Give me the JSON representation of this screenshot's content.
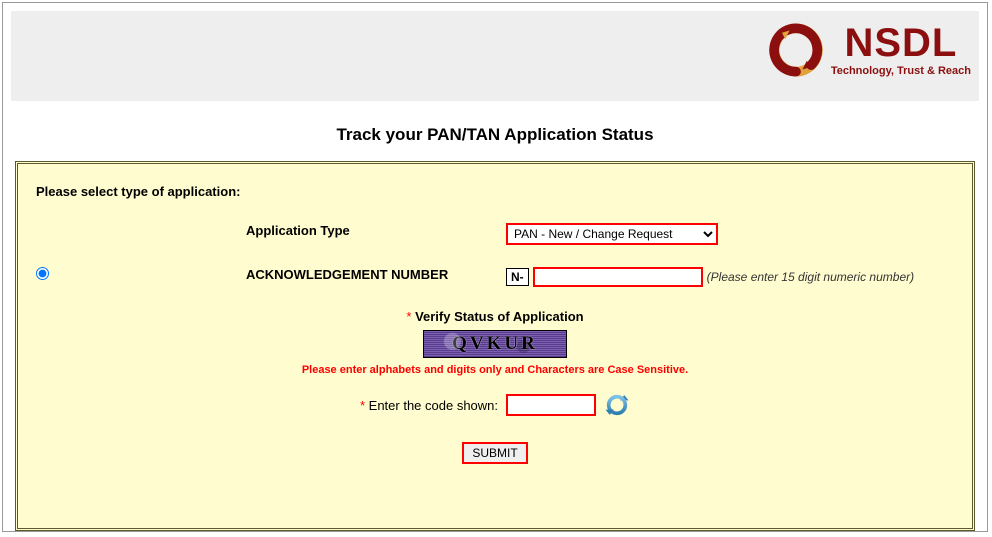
{
  "brand": {
    "name": "NSDL",
    "tagline": "Technology, Trust & Reach"
  },
  "page": {
    "heading": "Track your PAN/TAN Application Status"
  },
  "form": {
    "instruction": "Please select type of application:",
    "app_type_label": "Application Type",
    "app_type_selected": "PAN - New / Change Request",
    "app_type_options": [
      "PAN - New / Change Request"
    ],
    "ack_label": "ACKNOWLEDGEMENT NUMBER",
    "ack_prefix": "N-",
    "ack_hint": "(Please enter 15 digit numeric number)",
    "verify_title": "Verify Status of Application",
    "captcha_text": "QVKUR",
    "captcha_warn": "Please enter alphabets and digits only and Characters are Case Sensitive.",
    "enter_code_label": "Enter the code shown:",
    "submit_label": "SUBMIT"
  }
}
